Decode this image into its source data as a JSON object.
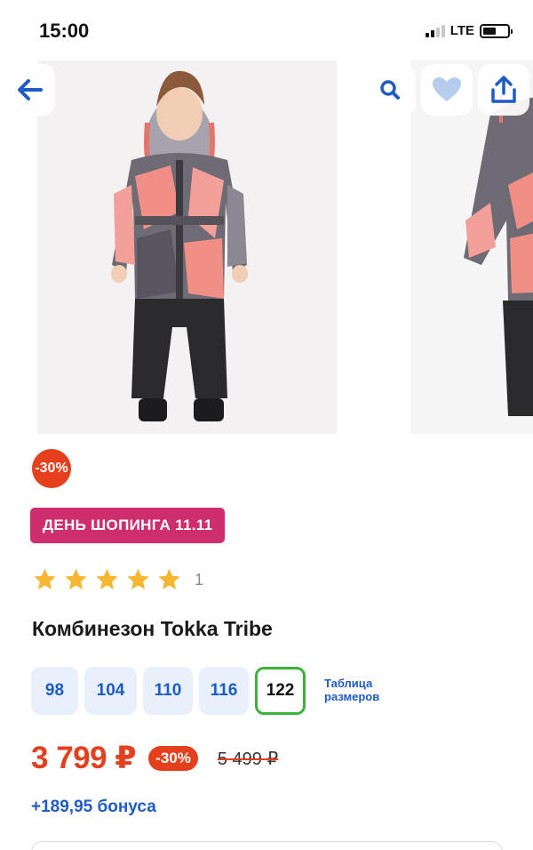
{
  "status_bar": {
    "time": "15:00",
    "network": "LTE"
  },
  "colors": {
    "accent_blue": "#1f5bc4",
    "discount_red": "#e4401e",
    "promo_pink": "#cf2e6e",
    "star": "#f5b731",
    "selected_size": "#3cb43c"
  },
  "nav": {
    "back_icon": "arrow-left-icon",
    "search_icon": "search-icon",
    "favorite_icon": "heart-icon",
    "share_icon": "share-icon"
  },
  "product": {
    "discount_badge": "-30%",
    "promo_label": "ДЕНЬ ШОПИНГА 11.11",
    "rating": {
      "stars": 5,
      "count": "1"
    },
    "title": "Комбинезон Tokka Tribe",
    "sizes": [
      {
        "label": "98",
        "selected": false
      },
      {
        "label": "104",
        "selected": false
      },
      {
        "label": "110",
        "selected": false
      },
      {
        "label": "116",
        "selected": false
      },
      {
        "label": "122",
        "selected": true
      }
    ],
    "size_table_link": "Таблица размеров",
    "price": "3 799 ₽",
    "price_discount": "-30%",
    "old_price": "5 499 ₽",
    "bonus": "+189,95 бонуса"
  }
}
